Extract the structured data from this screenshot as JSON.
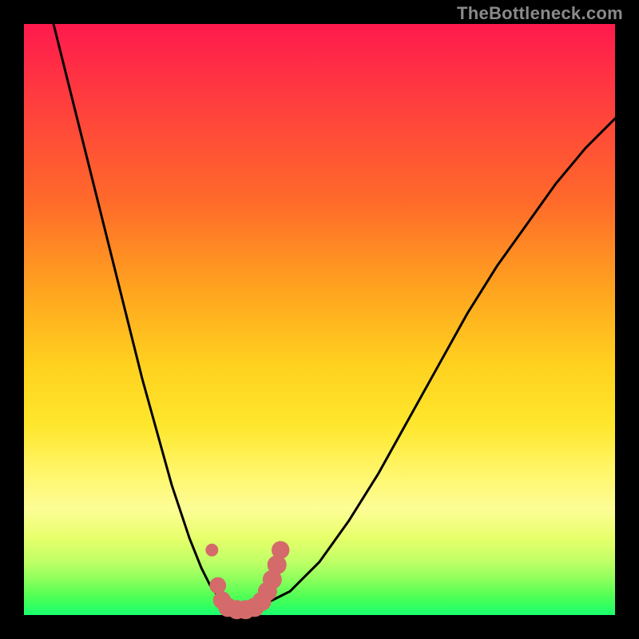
{
  "attribution": "TheBottleneck.com",
  "colors": {
    "frame": "#000000",
    "curve_stroke": "#000000",
    "marker_fill": "#d46a6a",
    "gradient_top": "#ff1a4d",
    "gradient_bottom": "#1aff6e"
  },
  "chart_data": {
    "type": "line",
    "title": "",
    "xlabel": "",
    "ylabel": "",
    "xlim": [
      0,
      100
    ],
    "ylim": [
      0,
      100
    ],
    "series": [
      {
        "name": "bottleneck-curve",
        "x": [
          5,
          10,
          15,
          20,
          25,
          28,
          30,
          31.5,
          33,
          35,
          37,
          38.5,
          40,
          45,
          50,
          55,
          60,
          65,
          70,
          75,
          80,
          85,
          90,
          95,
          100
        ],
        "y": [
          100,
          80,
          60,
          40,
          22,
          13,
          8,
          5,
          3,
          1.5,
          1,
          1,
          1.5,
          4,
          9,
          16,
          24,
          33,
          42,
          51,
          59,
          66,
          73,
          79,
          84
        ]
      }
    ],
    "curve_minimum_x": 36,
    "markers": {
      "name": "optimal-range",
      "note": "thick rounded segment near trough",
      "points": [
        {
          "x": 31.8,
          "y": 11.0,
          "r": 1.0
        },
        {
          "x": 32.8,
          "y": 5.0,
          "r": 1.3
        },
        {
          "x": 33.5,
          "y": 2.5,
          "r": 1.4
        },
        {
          "x": 34.5,
          "y": 1.3,
          "r": 1.5
        },
        {
          "x": 36.0,
          "y": 0.9,
          "r": 1.5
        },
        {
          "x": 37.5,
          "y": 0.9,
          "r": 1.5
        },
        {
          "x": 39.0,
          "y": 1.3,
          "r": 1.5
        },
        {
          "x": 40.2,
          "y": 2.3,
          "r": 1.5
        },
        {
          "x": 41.2,
          "y": 4.0,
          "r": 1.5
        },
        {
          "x": 42.0,
          "y": 6.0,
          "r": 1.5
        },
        {
          "x": 42.8,
          "y": 8.5,
          "r": 1.5
        },
        {
          "x": 43.4,
          "y": 11.0,
          "r": 1.4
        }
      ]
    }
  }
}
